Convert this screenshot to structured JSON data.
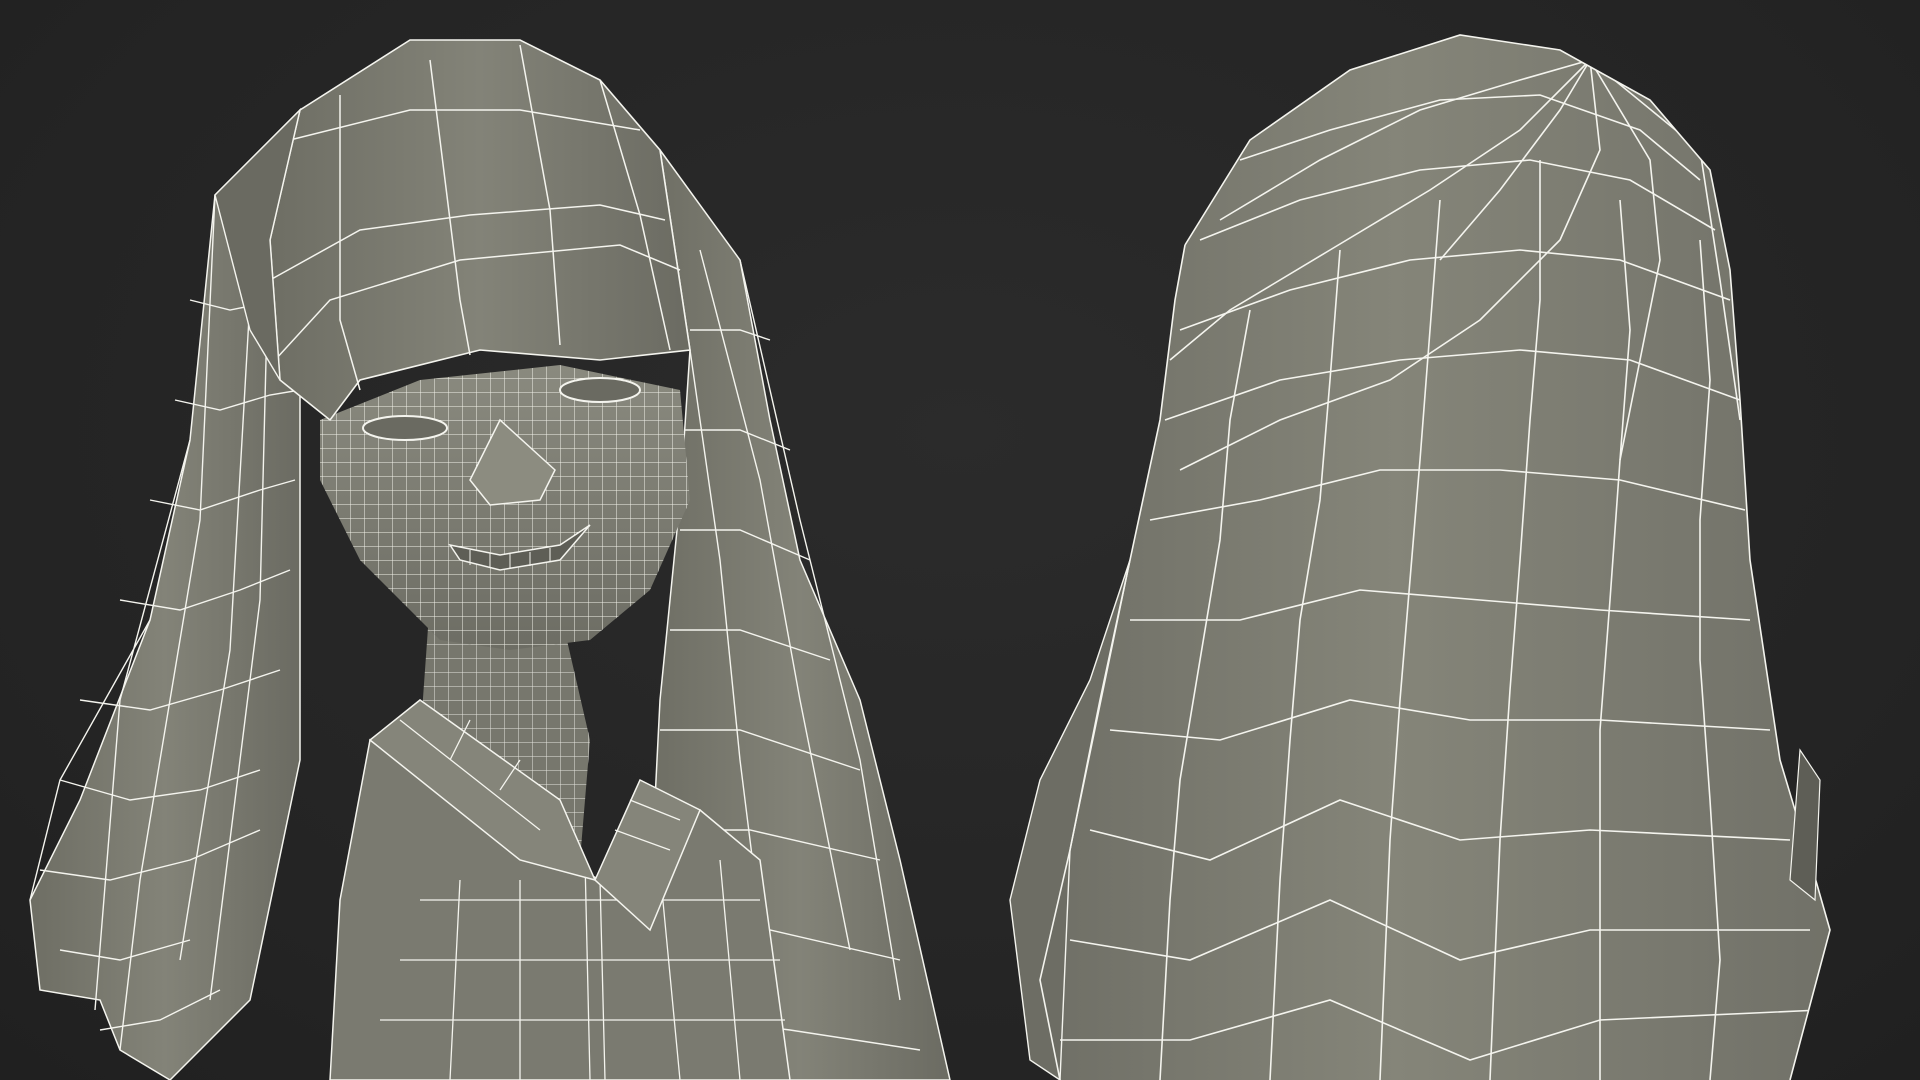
{
  "scene": {
    "background_color": "#262626",
    "mesh_fill_color": "#7d7d72",
    "mesh_shadow_color": "#5b5b53",
    "wire_color": "#f4f4ee",
    "views": [
      {
        "name": "front-view"
      },
      {
        "name": "back-view"
      }
    ]
  }
}
